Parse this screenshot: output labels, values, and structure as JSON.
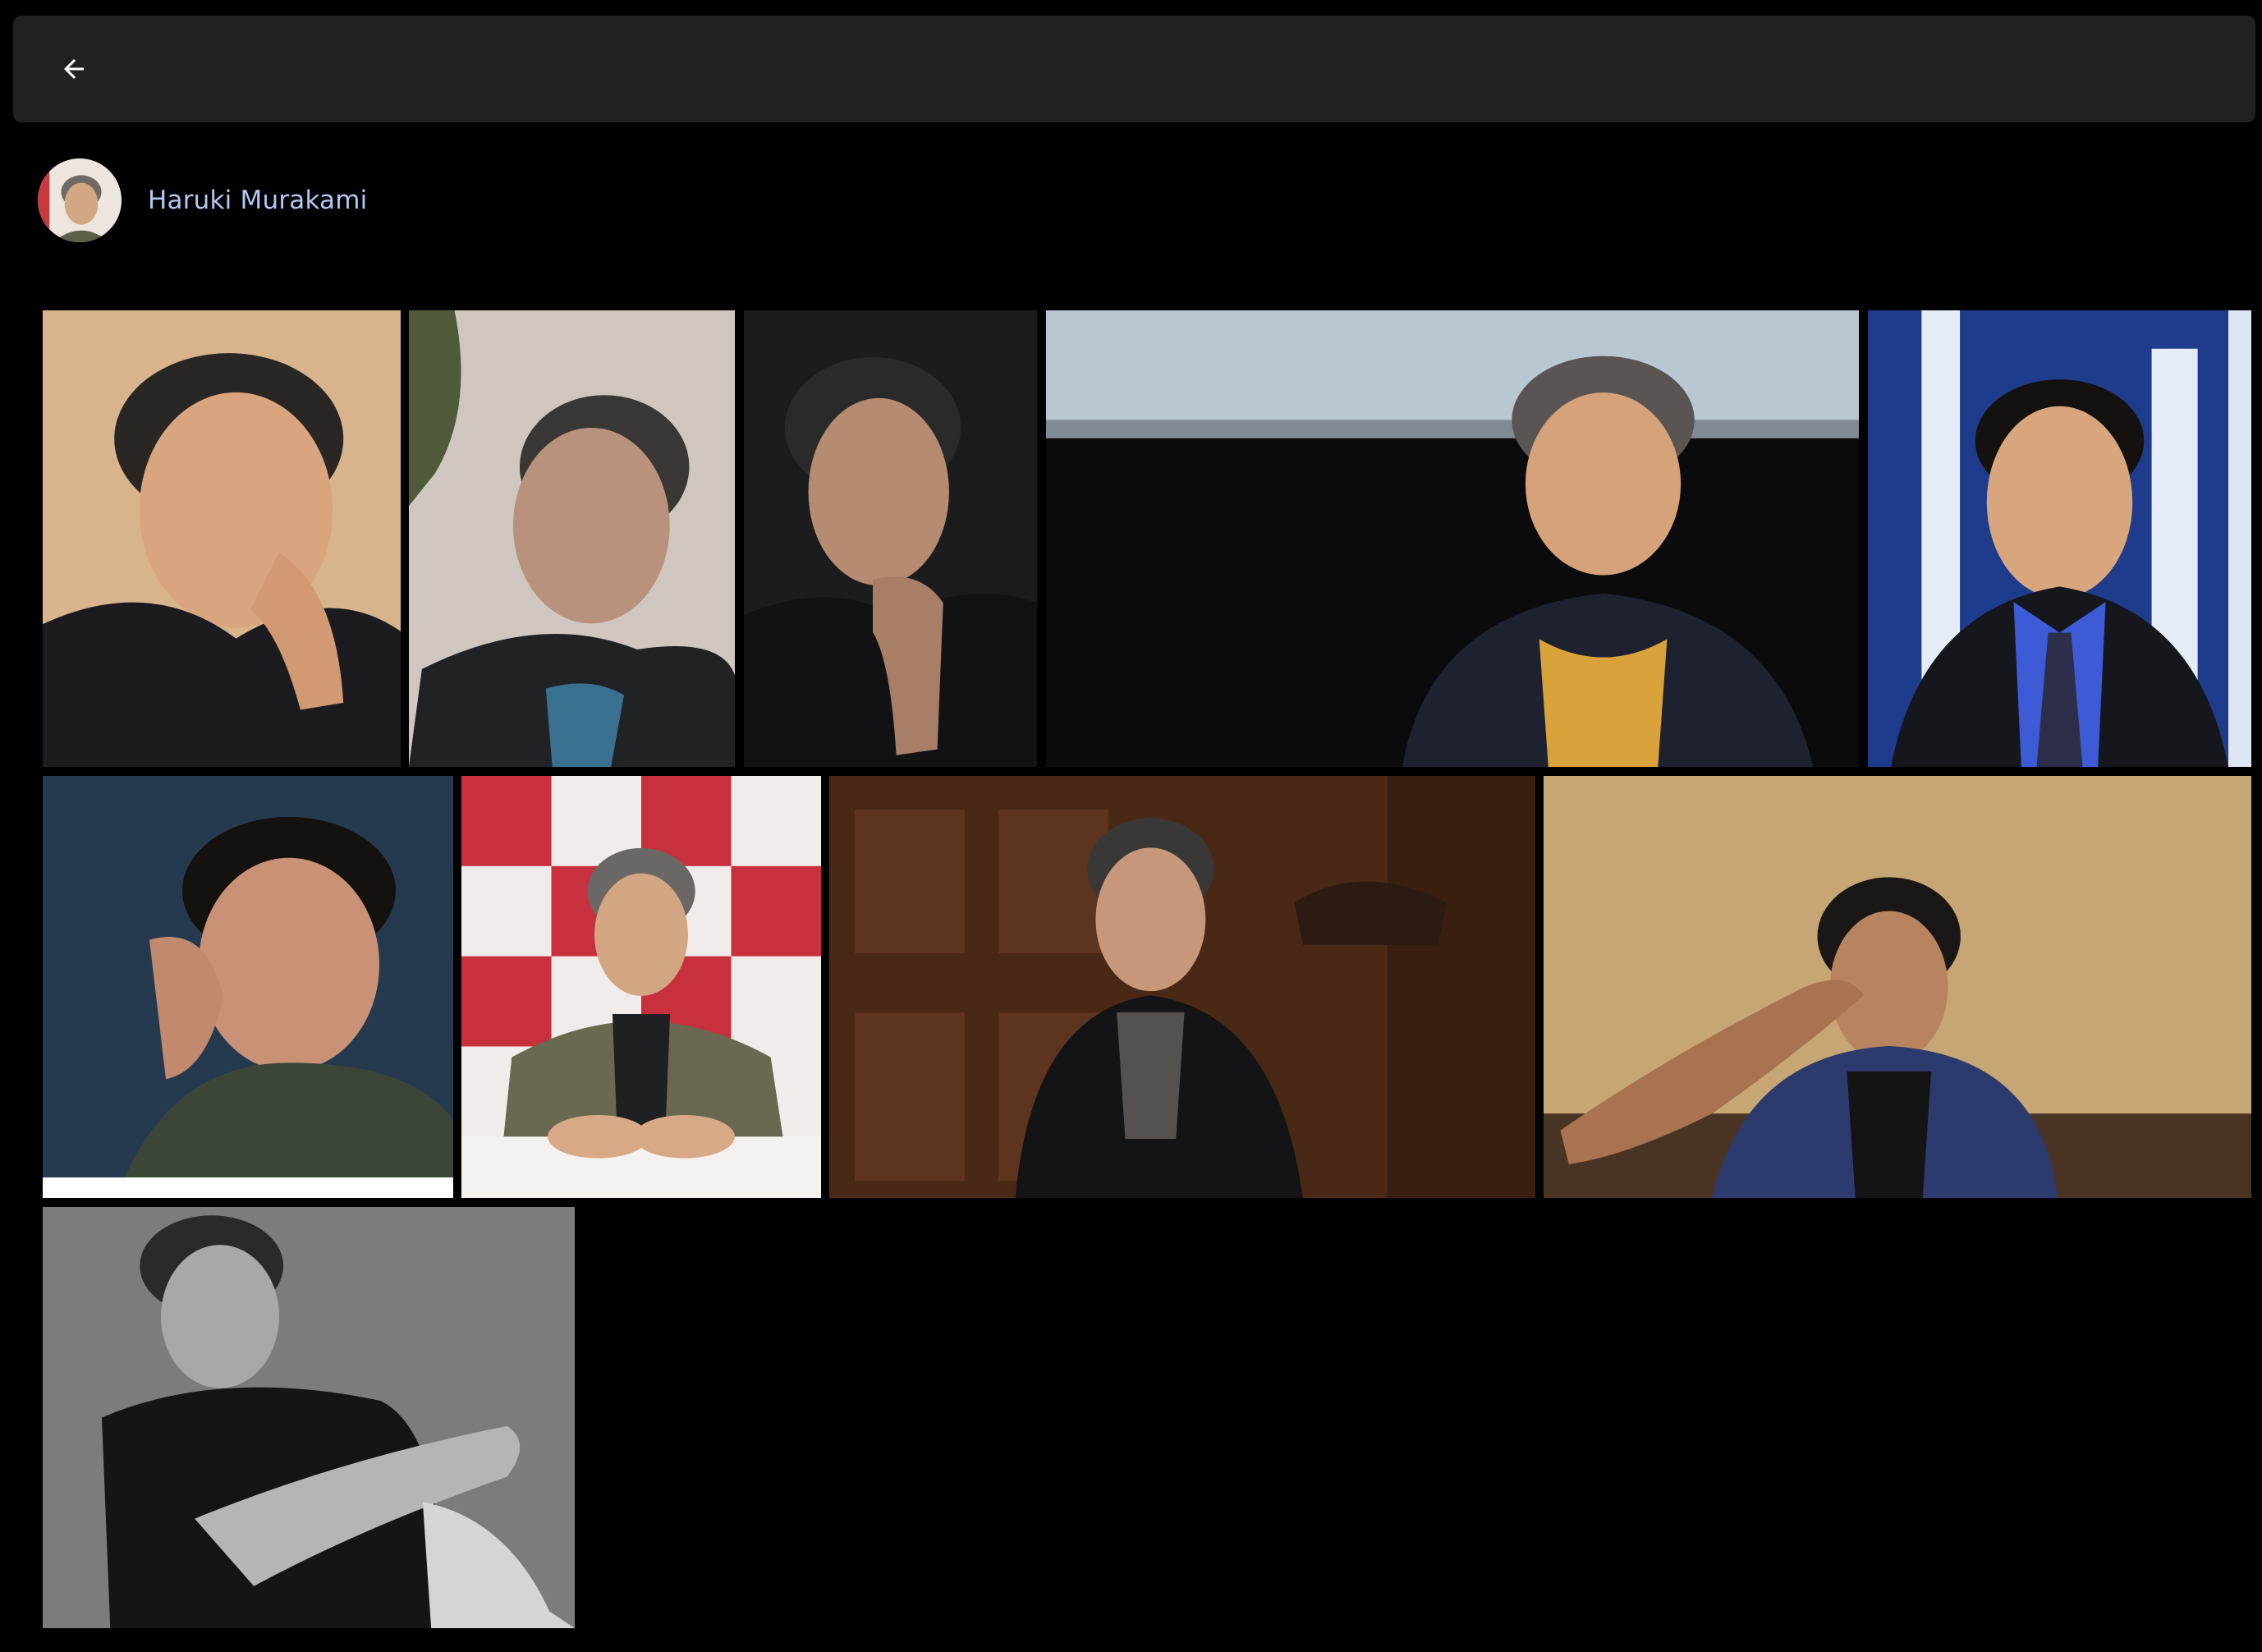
{
  "topbar": {
    "back_icon": "arrow-left-icon"
  },
  "person": {
    "name": "Haruki Murakami",
    "avatar_icon": "avatar"
  },
  "colors": {
    "background": "#000000",
    "topbar": "#212121",
    "name_link": "#b3c8f2",
    "icon": "#ffffff"
  },
  "photos": [
    {
      "id": "p1",
      "bg": "#d8b48d",
      "face": "#d9a57e",
      "clothes": "#1c1c20",
      "hair": "#2a2624"
    },
    {
      "id": "p2",
      "bg": "#cfc7bf",
      "face": "#b8927c",
      "clothes": "#202226",
      "hair": "#3b3734"
    },
    {
      "id": "p3",
      "bg": "#1c1c1e",
      "face": "#b58b71",
      "clothes": "#121214",
      "hair": "#2b2a2a"
    },
    {
      "id": "p4",
      "bg": "#0b0b0d",
      "face": "#d5a27a",
      "clothes": "#1d2130",
      "hair": "#5a5552",
      "shirt": "#d9a23a",
      "screen": "#b9c7d3"
    },
    {
      "id": "p5",
      "bg": "#1f3b8c",
      "face": "#d7a67d",
      "clothes": "#15171d",
      "hair": "#14110f",
      "shirt": "#3d5bd6"
    },
    {
      "id": "p6",
      "bg": "#263a4f",
      "face": "#c99276",
      "clothes": "#3b4639",
      "hair": "#14110f"
    },
    {
      "id": "p7",
      "bg": "#c8303e",
      "face": "#d2a583",
      "clothes": "#6a6850",
      "hair": "#6b6764"
    },
    {
      "id": "p8",
      "bg": "#4a2816",
      "face": "#c6977a",
      "clothes": "#141416",
      "hair": "#3a3836"
    },
    {
      "id": "p9",
      "bg": "#c6a674",
      "face": "#b7845f",
      "clothes": "#2c3a6e",
      "hair": "#1a1716"
    },
    {
      "id": "p10",
      "bg": "#7c7c7c",
      "face": "#a8a8a8",
      "clothes": "#151515",
      "hair": "#2a2a2a"
    }
  ]
}
